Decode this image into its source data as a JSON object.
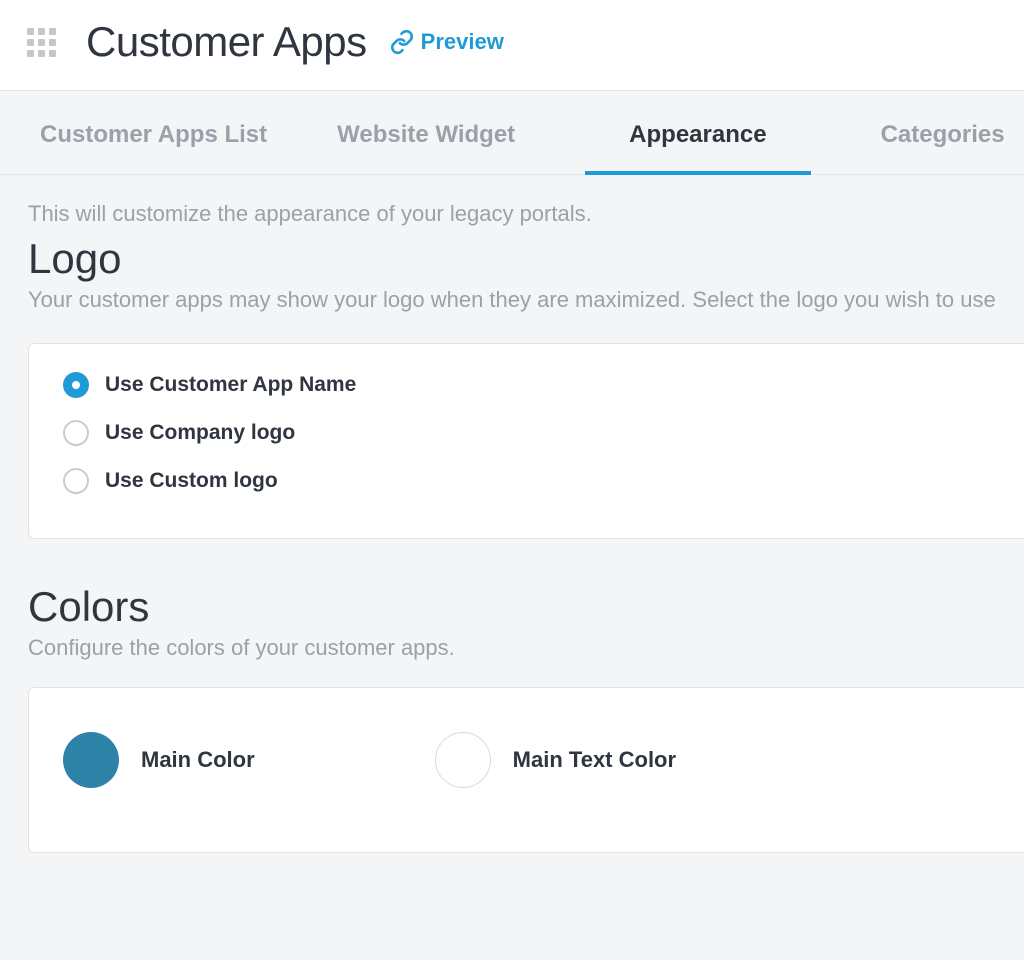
{
  "header": {
    "title": "Customer Apps",
    "preview_label": "Preview"
  },
  "tabs": [
    {
      "label": "Customer Apps List",
      "active": false
    },
    {
      "label": "Website Widget",
      "active": false
    },
    {
      "label": "Appearance",
      "active": true
    },
    {
      "label": "Categories",
      "active": false
    }
  ],
  "intro": "This will customize the appearance of your legacy portals.",
  "logo_section": {
    "heading": "Logo",
    "description": "Your customer apps may show your logo when they are maximized. Select the logo you wish to use",
    "options": [
      {
        "label": "Use Customer App Name",
        "selected": true
      },
      {
        "label": "Use Company logo",
        "selected": false
      },
      {
        "label": "Use Custom logo",
        "selected": false
      }
    ]
  },
  "colors_section": {
    "heading": "Colors",
    "description": "Configure the colors of your customer apps.",
    "items": [
      {
        "label": "Main Color",
        "value": "#2d82a8"
      },
      {
        "label": "Main Text Color",
        "value": "#ffffff"
      }
    ]
  }
}
